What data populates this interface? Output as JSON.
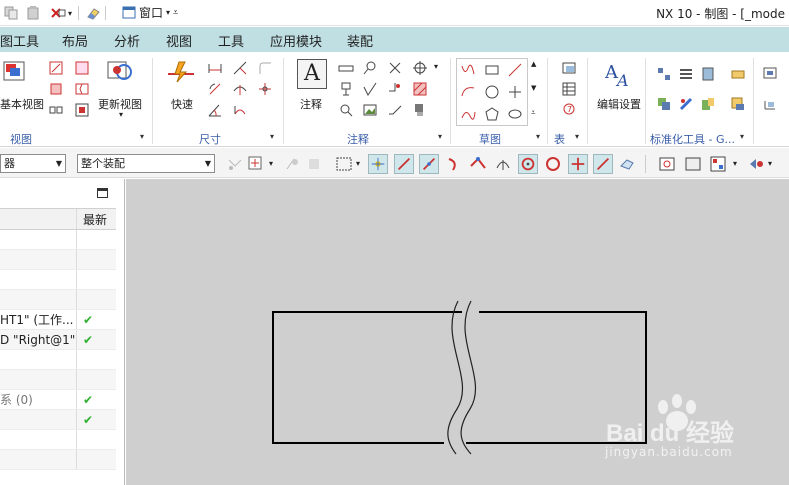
{
  "titlebar": {
    "window_menu_label": "窗口",
    "title": "NX 10 - 制图 - [_mode"
  },
  "tabs": [
    "图工具",
    "布局",
    "分析",
    "视图",
    "工具",
    "应用模块",
    "装配"
  ],
  "ribbon": {
    "view_group": {
      "base_view_label": "基本视图",
      "update_view_label": "更新视图",
      "group_label": "视图"
    },
    "dimension_group": {
      "rapid_label": "快速",
      "group_label": "尺寸"
    },
    "annotation_group": {
      "note_label": "注释",
      "group_label": "注释"
    },
    "sketch_group": {
      "group_label": "草图"
    },
    "table_group": {
      "group_label": "表"
    },
    "settings_group": {
      "edit_settings_label": "编辑设置"
    },
    "standard_tools_group": {
      "group_label": "标准化工具 - G..."
    }
  },
  "toolbar": {
    "filter_select_value": "器",
    "assembly_select_value": "整个装配"
  },
  "navigator": {
    "column_header_latest": "最新",
    "rows": [
      {
        "name": "",
        "latest": ""
      },
      {
        "name": "",
        "latest": ""
      },
      {
        "name": "",
        "latest": ""
      },
      {
        "name": "",
        "latest": ""
      },
      {
        "name": "HT1\" (工作...",
        "latest": "✔"
      },
      {
        "name": "D \"Right@1\"",
        "latest": "✔"
      },
      {
        "name": "",
        "latest": ""
      },
      {
        "name": "",
        "latest": ""
      },
      {
        "name": "系 (0)",
        "latest": "✔"
      },
      {
        "name": "",
        "latest": "✔"
      },
      {
        "name": "",
        "latest": ""
      },
      {
        "name": "",
        "latest": ""
      }
    ]
  },
  "watermark": {
    "logo_text": "Bai du 经验",
    "url": "jingyan.baidu.com"
  }
}
